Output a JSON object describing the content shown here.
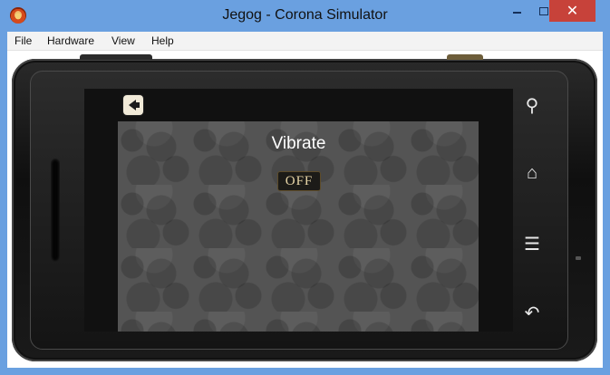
{
  "window": {
    "title": "Jegog - Corona Simulator",
    "close_glyph": "✕"
  },
  "menubar": {
    "items": [
      "File",
      "Hardware",
      "View",
      "Help"
    ]
  },
  "app": {
    "screen_title": "Vibrate",
    "toggle_label": "OFF"
  },
  "device": {
    "soft_keys": {
      "search": "⚲",
      "home": "⌂",
      "menu": "☰",
      "back": "↶"
    }
  },
  "icons": [
    "app-icon",
    "back-arrow-icon",
    "search-icon",
    "home-icon",
    "menu-icon",
    "back-icon"
  ]
}
